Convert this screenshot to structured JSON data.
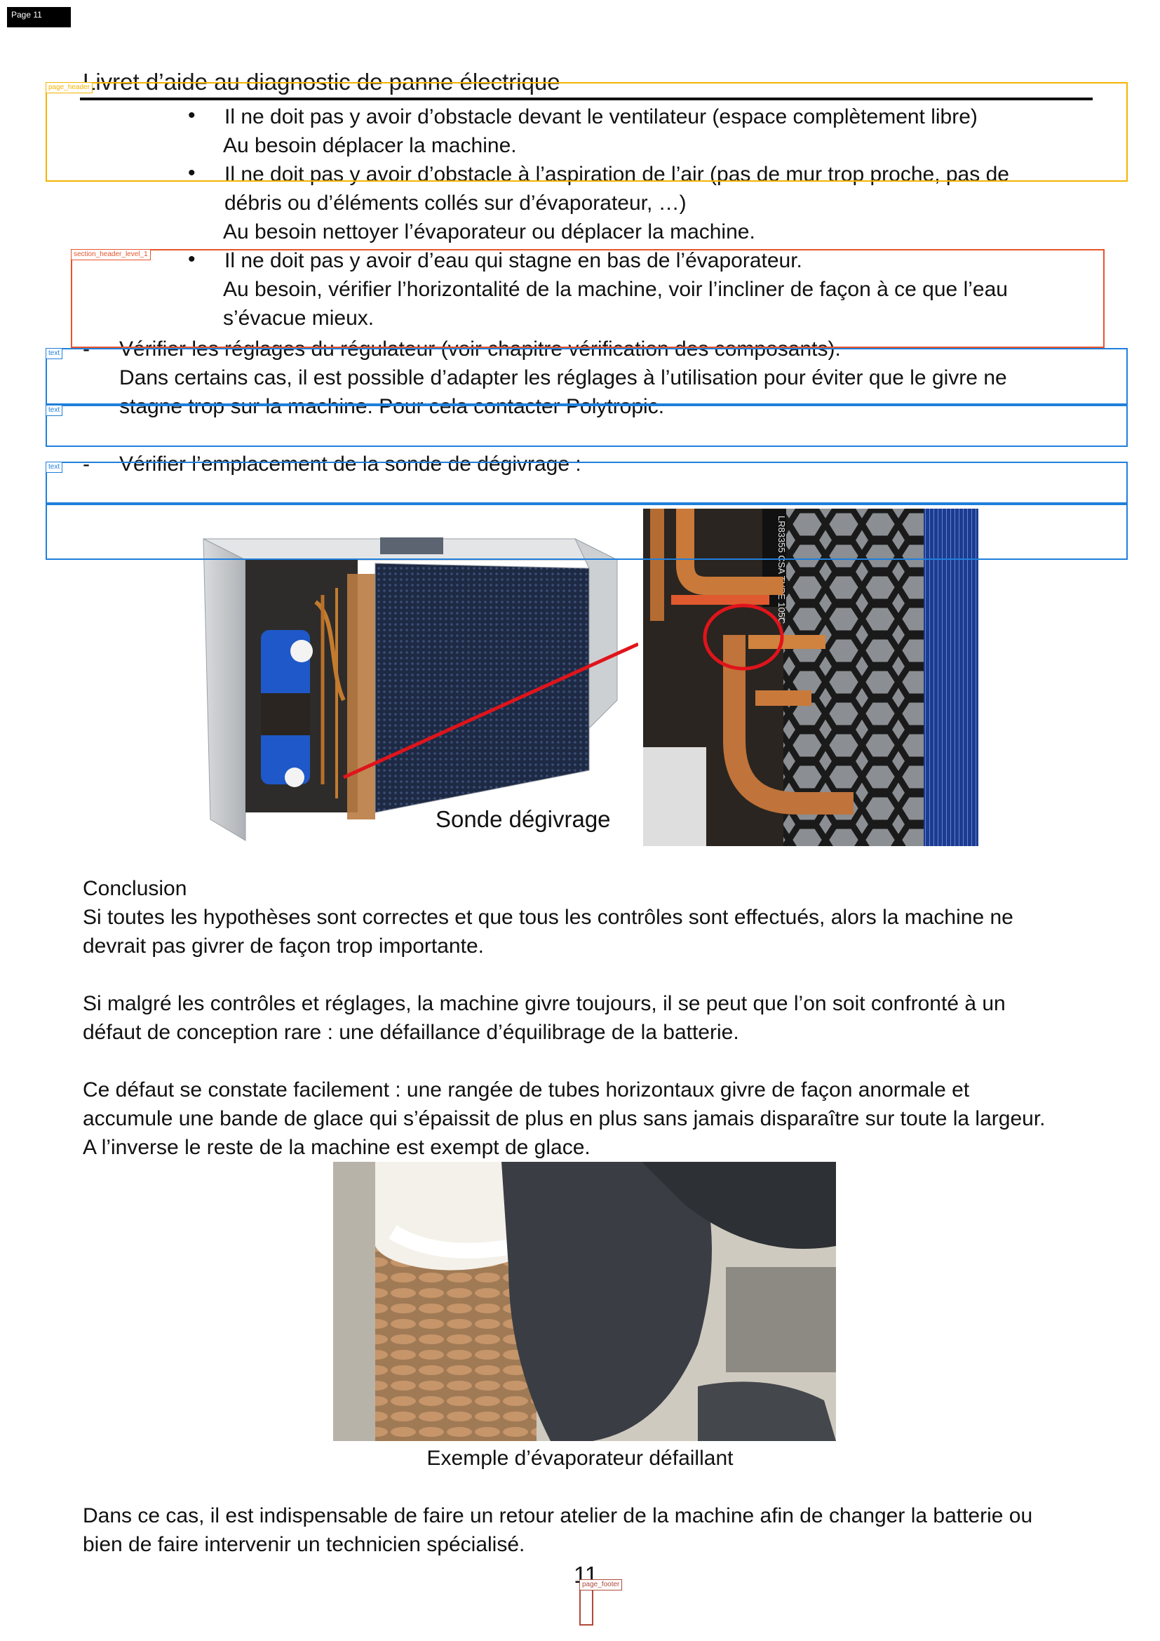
{
  "page_tag": "Page 11",
  "header": {
    "title": "Livret d’aide au diagnostic de panne électrique"
  },
  "annotations": {
    "page_header": "page_header",
    "section_header": "section_header_level_1",
    "text1": "text",
    "text2": "text",
    "text3": "text",
    "page_footer": "page_footer"
  },
  "bullets": [
    {
      "marker": "•",
      "line1": "Il ne doit pas y avoir d’obstacle devant le ventilateur (espace complètement libre)",
      "line2": "Au besoin déplacer la machine."
    },
    {
      "marker": "•",
      "line1": "Il ne doit pas y avoir d’obstacle à l’aspiration de l’air (pas de mur trop proche, pas de",
      "line1b": "débris ou d’éléments collés sur d’évaporateur, …)",
      "line2": "Au besoin nettoyer l’évaporateur ou déplacer la machine."
    },
    {
      "marker": "•",
      "line1": "Il ne doit pas y avoir d’eau qui stagne en bas de l’évaporateur.",
      "line2": "Au besoin, vérifier l’horizontalité de la machine, voir l’incliner de façon à ce que l’eau",
      "line3": "s’évacue mieux."
    }
  ],
  "dash_items": [
    {
      "marker": "-",
      "line1": "Vérifier les réglages du régulateur (voir chapitre vérification des composants).",
      "line2": "Dans certains cas, il est possible d’adapter les réglages à l’utilisation pour éviter que le givre ne",
      "line3": "stagne trop sur la machine. Pour cela contacter Polytropic."
    },
    {
      "marker": "-",
      "line1": "Vérifier l’emplacement de la sonde de dégivrage :"
    }
  ],
  "figure1": {
    "caption": "Sonde dégivrage",
    "hose_text": "LR83355  CSA  TYPE  105C"
  },
  "conclusion": {
    "title": "Conclusion",
    "p1_l1": "Si toutes les hypothèses sont correctes et que tous les contrôles sont effectués, alors la machine ne",
    "p1_l2": "devrait pas givrer de façon trop importante.",
    "p2_l1": "Si malgré les contrôles et réglages, la machine givre toujours, il se peut que l’on soit confronté à un",
    "p2_l2": "défaut de conception rare : une défaillance d’équilibrage de la batterie.",
    "p3_l1": "Ce défaut se constate facilement : une rangée de tubes horizontaux givre de façon anormale et",
    "p3_l2": "accumule une bande de glace qui s’épaissit de plus en plus sans jamais disparaître sur toute la largeur.",
    "p3_l3": "A l’inverse le reste de la machine est exempt de glace."
  },
  "figure2": {
    "caption": "Exemple d’évaporateur défaillant"
  },
  "final": {
    "l1": "Dans ce cas, il est indispensable de faire un retour atelier de la machine afin de changer la batterie ou",
    "l2": "bien de faire intervenir un technicien spécialisé."
  },
  "page_number": "11",
  "colors": {
    "annotation_orange": "#f4b400",
    "annotation_red": "#e8542c",
    "annotation_blue": "#1f7fdc",
    "callout_red": "#e0141b"
  }
}
